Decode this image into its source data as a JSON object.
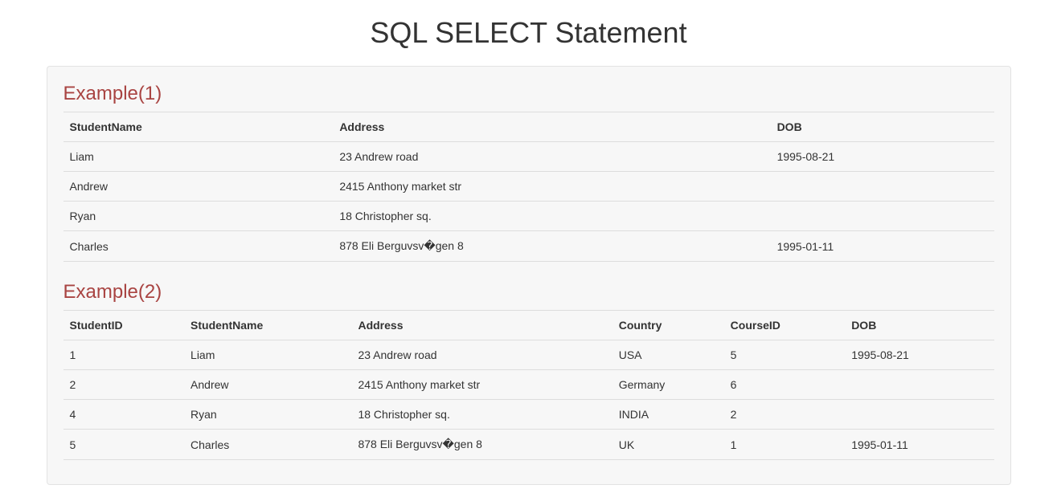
{
  "title": "SQL SELECT Statement",
  "example1": {
    "heading": "Example(1)",
    "columns": [
      "StudentName",
      "Address",
      "DOB"
    ],
    "rows": [
      {
        "StudentName": "Liam",
        "Address": "23 Andrew road",
        "DOB": "1995-08-21"
      },
      {
        "StudentName": "Andrew",
        "Address": "2415 Anthony market str",
        "DOB": ""
      },
      {
        "StudentName": "Ryan",
        "Address": "18 Christopher sq.",
        "DOB": ""
      },
      {
        "StudentName": "Charles",
        "Address": "878 Eli Berguvsv�gen 8",
        "DOB": "1995-01-11"
      }
    ]
  },
  "example2": {
    "heading": "Example(2)",
    "columns": [
      "StudentID",
      "StudentName",
      "Address",
      "Country",
      "CourseID",
      "DOB"
    ],
    "rows": [
      {
        "StudentID": "1",
        "StudentName": "Liam",
        "Address": "23 Andrew road",
        "Country": "USA",
        "CourseID": "5",
        "DOB": "1995-08-21"
      },
      {
        "StudentID": "2",
        "StudentName": "Andrew",
        "Address": "2415 Anthony market str",
        "Country": "Germany",
        "CourseID": "6",
        "DOB": ""
      },
      {
        "StudentID": "4",
        "StudentName": "Ryan",
        "Address": "18 Christopher sq.",
        "Country": "INDIA",
        "CourseID": "2",
        "DOB": ""
      },
      {
        "StudentID": "5",
        "StudentName": "Charles",
        "Address": "878 Eli Berguvsv�gen 8",
        "Country": "UK",
        "CourseID": "1",
        "DOB": "1995-01-11"
      }
    ]
  }
}
